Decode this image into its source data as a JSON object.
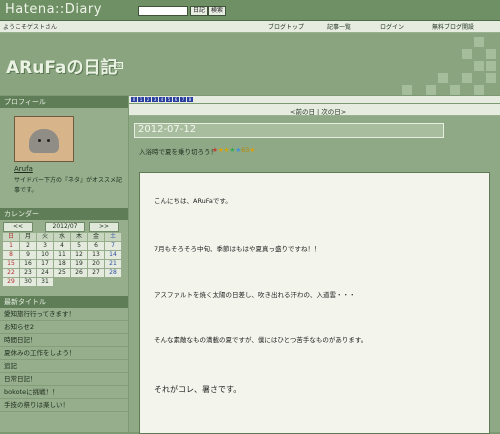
{
  "topbar": {
    "service": "Hatena::Diary",
    "search_btn1": "日記",
    "search_btn2": "検索"
  },
  "navbar": {
    "welcome": "ようこそゲストさん",
    "links": [
      "ブログトップ",
      "記事一覧",
      "ログイン",
      "無料ブログ開設"
    ]
  },
  "header": {
    "title": "ARuFaの日記",
    "rss": "RSS"
  },
  "sidebar": {
    "profile_title": "プロフィール",
    "profile_name": "Arufa",
    "profile_desc": "サイドバー下方の『ネタ』がオススメ記事です。",
    "calendar_title": "カレンダー",
    "cal_prev": "<<",
    "cal_month": "2012/07",
    "cal_next": ">>",
    "weekdays": [
      "日",
      "月",
      "火",
      "水",
      "木",
      "金",
      "土"
    ],
    "days": [
      "1",
      "2",
      "3",
      "4",
      "5",
      "6",
      "7",
      "8",
      "9",
      "10",
      "11",
      "12",
      "13",
      "14",
      "15",
      "16",
      "17",
      "18",
      "19",
      "20",
      "21",
      "22",
      "23",
      "24",
      "25",
      "26",
      "27",
      "28",
      "29",
      "30",
      "31"
    ],
    "recent_title": "最新タイトル",
    "recent": [
      "愛知旅行行ってきます！",
      "お知らせ2",
      "時間日記！",
      "夏休みの工作をしよう！",
      "追記",
      "日常日記！",
      "bokoteに挑戦！！",
      "手技の祭りは楽しい！"
    ]
  },
  "main": {
    "pages": [
      "0",
      "1",
      "2",
      "3",
      "4",
      "5",
      "6",
      "7",
      "8"
    ],
    "prevnext": "<前の日 | 次の日>",
    "date": "2012-07-12",
    "entry_title": "入浴時で夏を乗り切ろう！",
    "star_count": "63",
    "paragraphs": [
      "こんにちは、ARuFaです。",
      "7月もそろそろ中旬、季節はもはや夏真っ盛りですね！！",
      "アスファルトを焼く太陽の日差し、吹き出れる汗わの、入道雲・・・",
      "そんな素敵なもの満載の夏ですが、僕にはひとつ苦手なものがあります。",
      "それがコレ、暑さです。"
    ]
  }
}
